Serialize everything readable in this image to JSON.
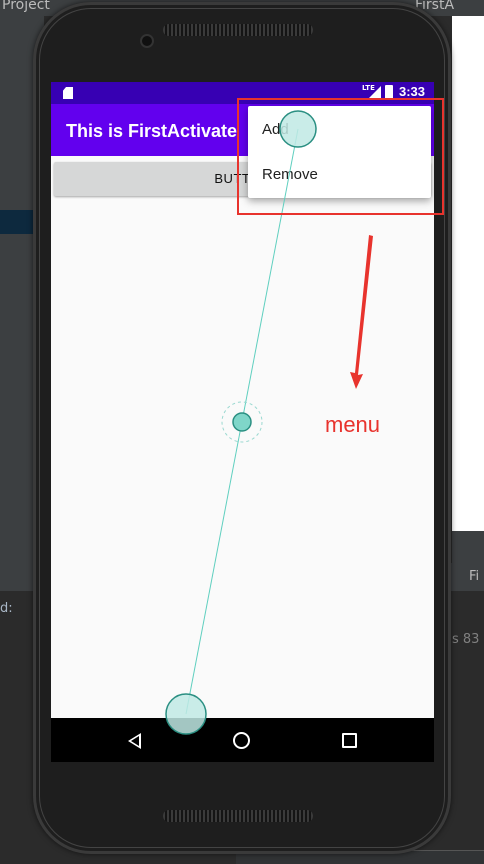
{
  "ide": {
    "top_left_text": "Project",
    "top_right_text": "FirstA",
    "bottom_left_text": "d:",
    "bottom_right_tab": "Fi",
    "bottom_right_text": "s 83"
  },
  "device": {
    "status_bar": {
      "network": "LTE",
      "time": "3:33"
    },
    "app_bar": {
      "title": "This is FirstActivate"
    },
    "main_button": {
      "label": "BUTTON"
    },
    "options_menu": {
      "items": [
        "Add",
        "Remove"
      ]
    },
    "nav_bar": {
      "back": "back-icon",
      "home": "home-icon",
      "recents": "recents-icon"
    }
  },
  "annotation": {
    "label": "menu",
    "color": "#e8332d"
  },
  "colors": {
    "status_bar": "#3700b3",
    "app_bar": "#6200ee",
    "touch_indicator": "#7fd6c9"
  }
}
